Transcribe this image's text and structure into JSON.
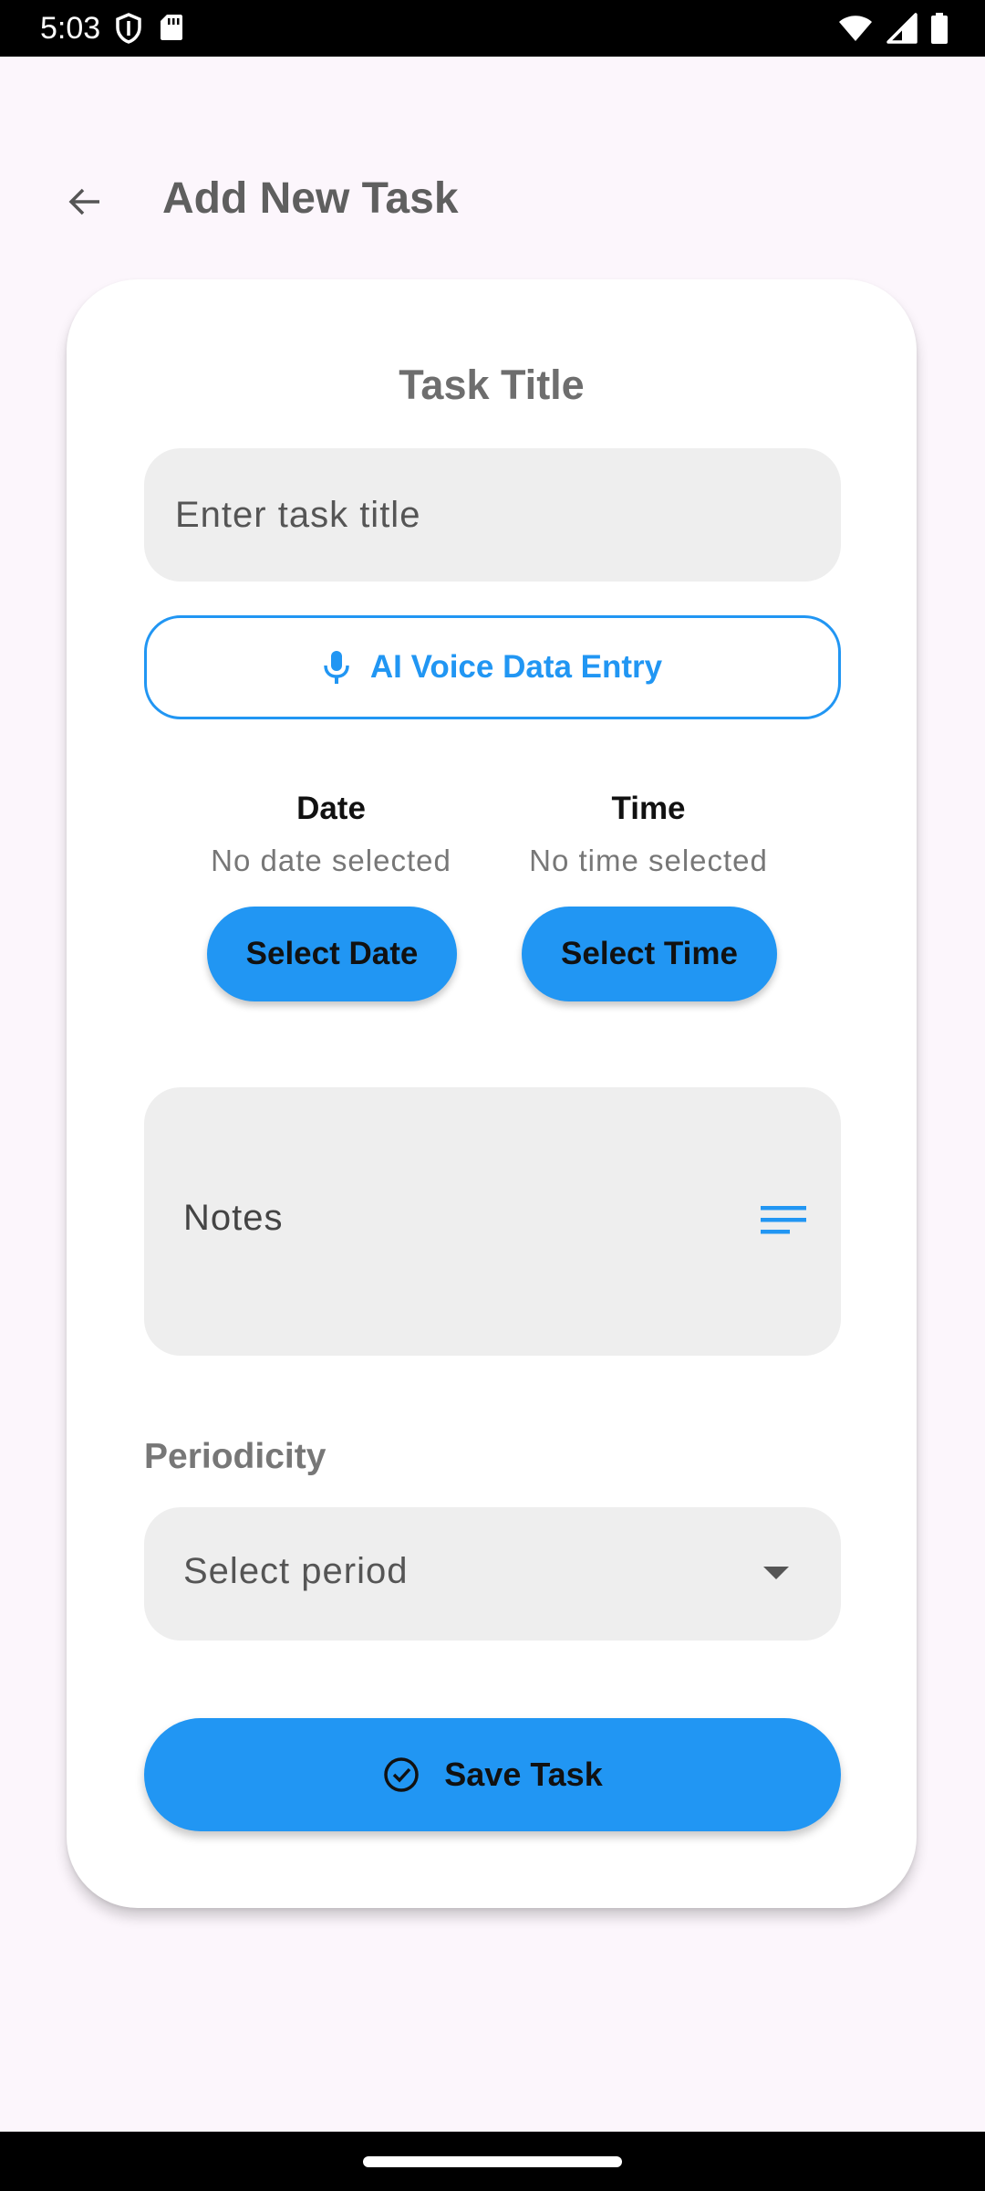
{
  "status_bar": {
    "time": "5:03"
  },
  "header": {
    "title": "Add New Task"
  },
  "form": {
    "section_title": "Task Title",
    "title_placeholder": "Enter task title",
    "voice_button_label": "AI Voice Data Entry",
    "date": {
      "label": "Date",
      "value": "No date selected",
      "button": "Select Date"
    },
    "time": {
      "label": "Time",
      "value": "No time selected",
      "button": "Select Time"
    },
    "notes_label": "Notes",
    "periodicity_label": "Periodicity",
    "period_value": "Select period",
    "save_button": "Save Task"
  },
  "colors": {
    "accent": "#2196f3",
    "background": "#fcf6fc",
    "field": "#eeeeee"
  }
}
